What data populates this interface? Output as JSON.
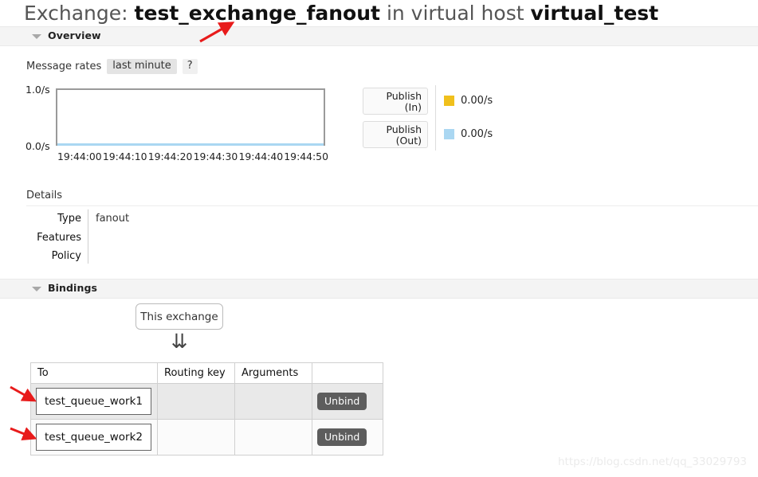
{
  "page": {
    "title_prefix": "Exchange:",
    "exchange_name": "test_exchange_fanout",
    "title_middle": "in virtual host",
    "vhost_name": "virtual_test"
  },
  "sections": {
    "overview": {
      "label": "Overview",
      "toggle_icon": "triangle-down-icon"
    },
    "bindings": {
      "label": "Bindings",
      "toggle_icon": "triangle-down-icon"
    }
  },
  "message_rates": {
    "label": "Message rates",
    "period": "last minute",
    "help": "?"
  },
  "chart_data": {
    "type": "line",
    "title": "Message rates",
    "xlabel": "",
    "ylabel": "",
    "ylim": [
      0.0,
      1.0
    ],
    "y_ticks": [
      "1.0/s",
      "0.0/s"
    ],
    "x": [
      "19:44:00",
      "19:44:10",
      "19:44:20",
      "19:44:30",
      "19:44:40",
      "19:44:50"
    ],
    "grid": false,
    "legend_position": "right",
    "series": [
      {
        "name": "Publish (In)",
        "button_line1": "Publish",
        "button_line2": "(In)",
        "color": "#f0c01c",
        "current_value": "0.00/s",
        "values": [
          0.0,
          0.0,
          0.0,
          0.0,
          0.0,
          0.0
        ]
      },
      {
        "name": "Publish (Out)",
        "button_line1": "Publish",
        "button_line2": "(Out)",
        "color": "#aad7f2",
        "current_value": "0.00/s",
        "values": [
          0.0,
          0.0,
          0.0,
          0.0,
          0.0,
          0.0
        ]
      }
    ]
  },
  "details": {
    "heading": "Details",
    "rows": [
      {
        "key": "Type",
        "value": "fanout"
      },
      {
        "key": "Features",
        "value": ""
      },
      {
        "key": "Policy",
        "value": ""
      }
    ]
  },
  "bindings": {
    "this_exchange_label": "This exchange",
    "arrow_glyph": "⇊",
    "columns": [
      "To",
      "Routing key",
      "Arguments",
      ""
    ],
    "rows": [
      {
        "to": "test_queue_work1",
        "routing_key": "",
        "arguments": "",
        "action": "Unbind"
      },
      {
        "to": "test_queue_work2",
        "routing_key": "",
        "arguments": "",
        "action": "Unbind"
      }
    ]
  },
  "watermark": {
    "text": "https://blog.csdn.net/qq_33029793"
  },
  "colors": {
    "publish_in": "#f0c01c",
    "publish_out": "#aad7f2",
    "annotation_arrow": "#e81b1b",
    "section_bar_bg": "#f4f4f4",
    "unbind_button": "#5d5d5d"
  }
}
